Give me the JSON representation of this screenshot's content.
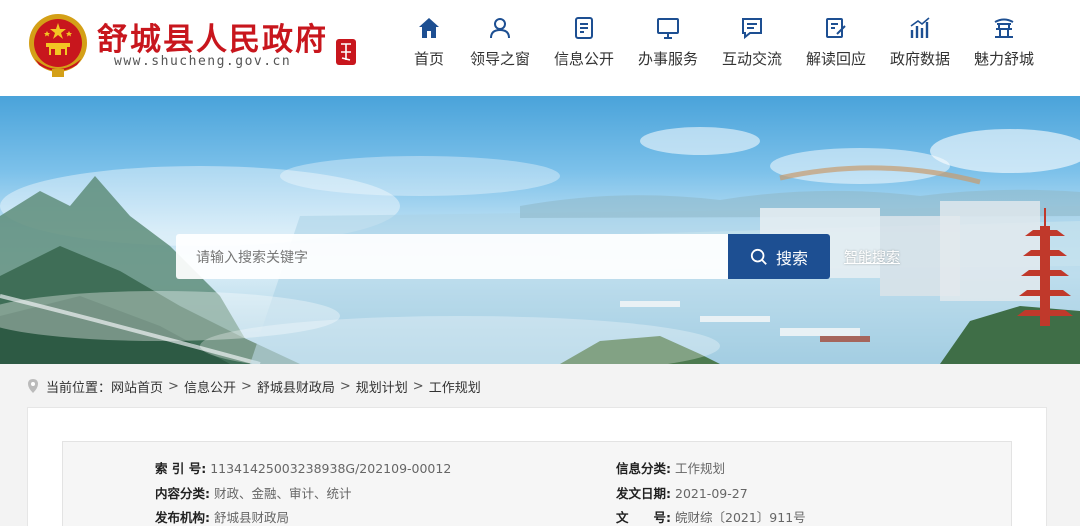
{
  "header": {
    "site_title": "舒城县人民政府",
    "site_domain": "www.shucheng.gov.cn"
  },
  "nav": [
    {
      "label": "首页",
      "icon": "home-icon"
    },
    {
      "label": "领导之窗",
      "icon": "user-icon"
    },
    {
      "label": "信息公开",
      "icon": "document-icon"
    },
    {
      "label": "办事服务",
      "icon": "monitor-icon"
    },
    {
      "label": "互动交流",
      "icon": "chat-icon"
    },
    {
      "label": "解读回应",
      "icon": "edit-icon"
    },
    {
      "label": "政府数据",
      "icon": "bar-chart-icon"
    },
    {
      "label": "魅力舒城",
      "icon": "landmark-icon"
    }
  ],
  "search": {
    "placeholder": "请输入搜索关键字",
    "button_label": "搜索",
    "smart_search_label": "智能搜索"
  },
  "breadcrumb": {
    "prefix": "当前位置：",
    "items": [
      "网站首页",
      "信息公开",
      "舒城县财政局",
      "规划计划",
      "工作规划"
    ],
    "separator": ">"
  },
  "info": {
    "index_label": "索 引 号:",
    "index_value": "11341425003238938G/202109-00012",
    "category_label": "信息分类:",
    "category_value": "工作规划",
    "content_label": "内容分类:",
    "content_value": "财政、金融、审计、统计",
    "date_label": "发文日期:",
    "date_value": "2021-09-27",
    "publisher_label": "发布机构:",
    "publisher_value": "舒城县财政局",
    "docno_label": "文　　号:",
    "docno_value": "皖财综〔2021〕911号"
  },
  "colors": {
    "brand_red": "#c8161d",
    "nav_blue": "#1d4f92",
    "search_button": "#1d4f92"
  }
}
